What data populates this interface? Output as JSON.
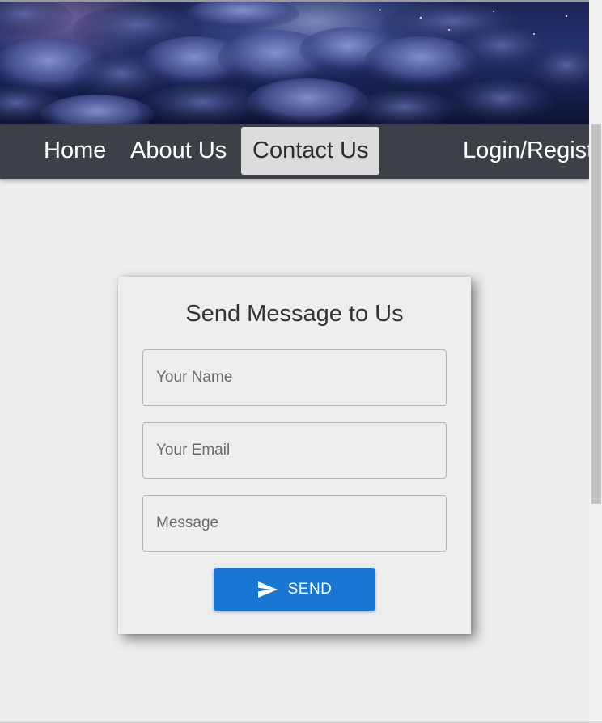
{
  "banner": {
    "image": "night-sky-clouds-banner"
  },
  "nav": {
    "items": [
      {
        "label": "Home",
        "active": false
      },
      {
        "label": "About Us",
        "active": false
      },
      {
        "label": "Contact Us",
        "active": true
      }
    ],
    "login_label": "Login/Regist",
    "active_bg": "#dcdcdc",
    "bar_color": "#3d4046"
  },
  "contact_form": {
    "title": "Send Message to Us",
    "name_placeholder": "Your Name",
    "email_placeholder": "Your Email",
    "message_placeholder": "Message",
    "send_label": "SEND",
    "send_icon": "send-icon",
    "button_color": "#1976d2"
  }
}
